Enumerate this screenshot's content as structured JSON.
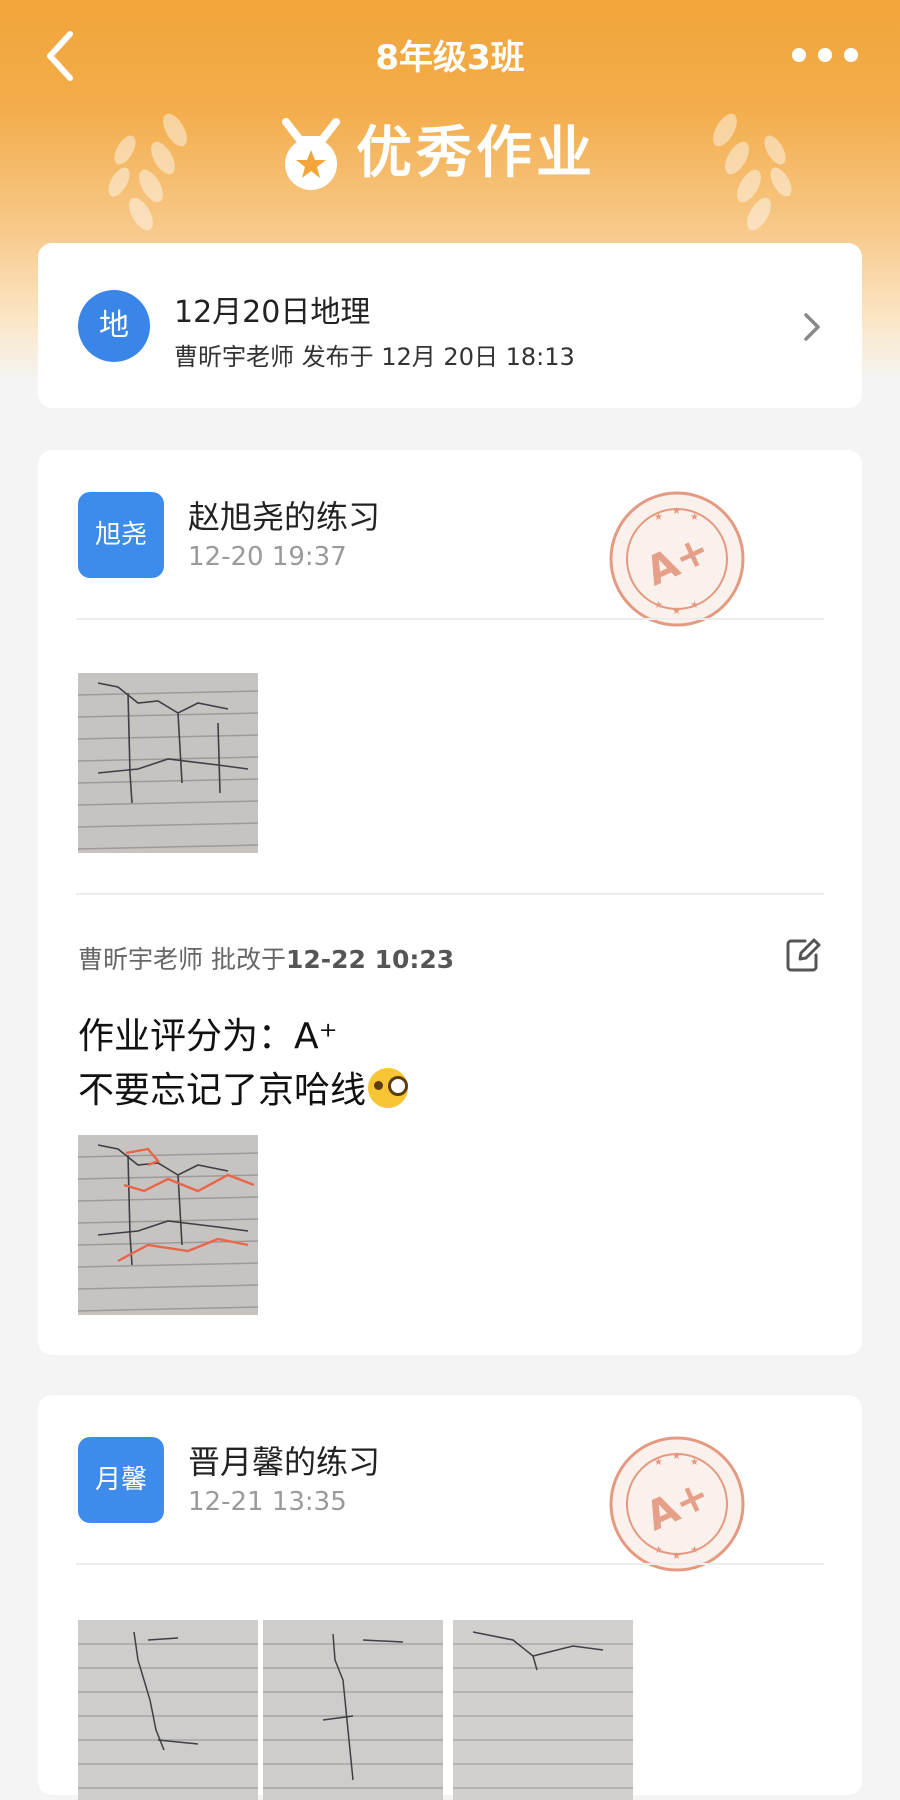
{
  "nav": {
    "title": "8年级3班"
  },
  "banner": {
    "title": "优秀作业"
  },
  "homework": {
    "subject_badge": "地",
    "title": "12月20日地理",
    "subtitle": "曹昕宇老师 发布于 12月 20日 18:13"
  },
  "submissions": [
    {
      "avatar_text": "旭尧",
      "name": "赵旭尧的练习",
      "time": "12-20 19:37",
      "grade_stamp": "A+",
      "review": {
        "teacher": "曹昕宇老师 批改于",
        "time": "12-22 10:23",
        "comment_line1": "作业评分为：A⁺",
        "comment_line2": "不要忘记了京哈线"
      }
    },
    {
      "avatar_text": "月馨",
      "name": "晋月馨的练习",
      "time": "12-21 13:35",
      "grade_stamp": "A+"
    }
  ],
  "colors": {
    "header_orange": "#f2a53a",
    "badge_blue": "#3a86e8",
    "stamp_color": "#e39a80"
  },
  "icons": [
    "back-arrow-icon",
    "more-dots-icon",
    "medal-icon",
    "chevron-right-icon",
    "grade-stamp-icon",
    "edit-icon",
    "monocle-emoji-icon"
  ]
}
